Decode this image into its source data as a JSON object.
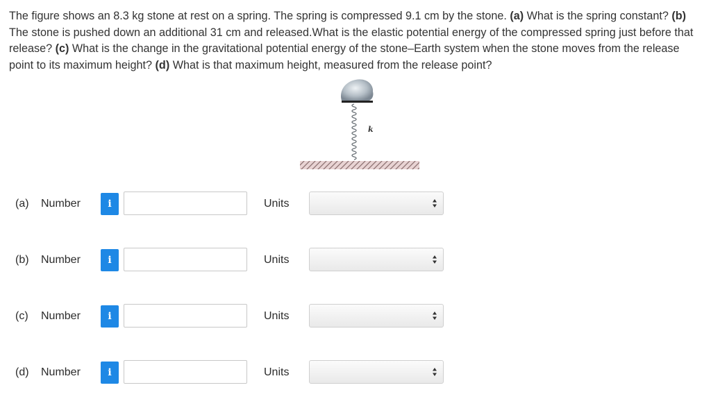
{
  "question": {
    "p1": "The figure shows an 8.3 kg stone at rest on a spring. The spring is compressed 9.1 cm by the stone. ",
    "a_tag": "(a)",
    "p2": " What is the spring constant? ",
    "b_tag": "(b)",
    "p3": " The stone is pushed down an additional 31 cm and released.What is the elastic potential energy of the compressed spring just before that release? ",
    "c_tag": "(c)",
    "p4": " What is the change in the gravitational potential energy of the stone–Earth system when the stone moves from the release point to its maximum height? ",
    "d_tag": "(d)",
    "p5": " What is that maximum height, measured from the release point?"
  },
  "figure": {
    "spring_label": "k"
  },
  "answers": [
    {
      "part": "(a)",
      "label": "Number",
      "info": "i",
      "value": "",
      "units_label": "Units",
      "units_value": ""
    },
    {
      "part": "(b)",
      "label": "Number",
      "info": "i",
      "value": "",
      "units_label": "Units",
      "units_value": ""
    },
    {
      "part": "(c)",
      "label": "Number",
      "info": "i",
      "value": "",
      "units_label": "Units",
      "units_value": ""
    },
    {
      "part": "(d)",
      "label": "Number",
      "info": "i",
      "value": "",
      "units_label": "Units",
      "units_value": ""
    }
  ],
  "colors": {
    "info_button": "#1e88e5",
    "stone": "#a9b4bd"
  }
}
